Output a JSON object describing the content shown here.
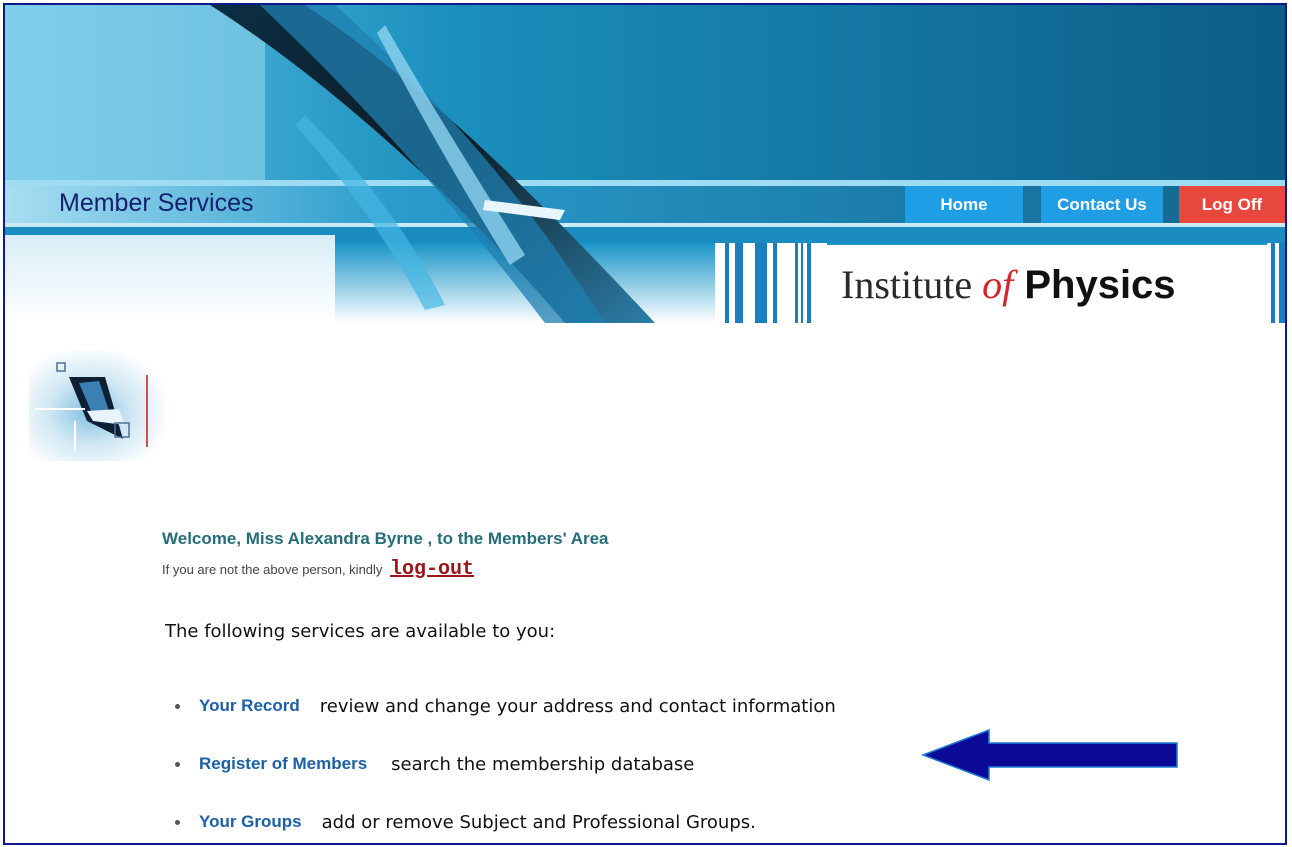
{
  "header": {
    "site_title": "Member Services",
    "nav": [
      {
        "label": "Home"
      },
      {
        "label": "Contact Us"
      },
      {
        "label": "Log Off"
      }
    ],
    "logo": {
      "part1": "Institute ",
      "part2": "of",
      "part3": " Physics"
    }
  },
  "main": {
    "welcome": "Welcome, Miss Alexandra Byrne , to the Members' Area",
    "not_you_prefix": "If you are not the above person, kindly",
    "logout_link": "log-out",
    "intro": "The following services are available to you:",
    "services": [
      {
        "link": "Your Record",
        "description": "review and change your address and contact information"
      },
      {
        "link": "Register of Members",
        "description": "search the membership database"
      },
      {
        "link": "Your Groups",
        "description": "add or remove Subject and Professional Groups."
      }
    ]
  },
  "colors": {
    "brand_navy": "#13216e",
    "nav_blue": "#1f9ee6",
    "logoff_red": "#e8473d",
    "welcome_teal": "#256d78",
    "link_blue": "#1d5fa6",
    "logout_red": "#a0131b",
    "arrow_navy": "#0a0a96"
  },
  "icons": [
    "iop-emblem-icon",
    "left-arrow-icon"
  ]
}
